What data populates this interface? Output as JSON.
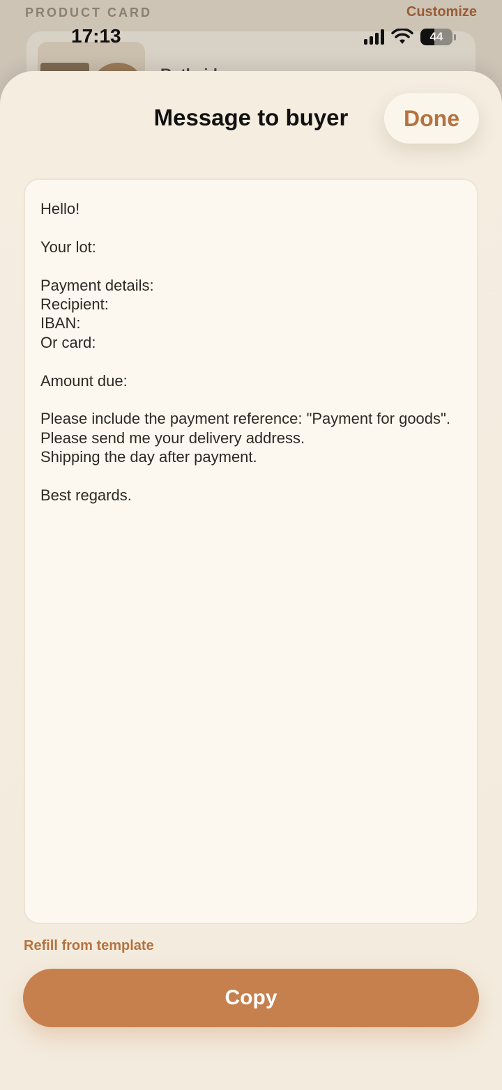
{
  "background": {
    "section_title": "PRODUCT CARD",
    "customize_label": "Customize",
    "card_title": "Rothsid..."
  },
  "status_bar": {
    "time": "17:13",
    "battery": "44"
  },
  "sheet": {
    "title": "Message to buyer",
    "done_label": "Done",
    "message": "Hello!\n\nYour lot:\n\nPayment details:\nRecipient:\nIBAN:\nOr card:\n\nAmount due:\n\nPlease include the payment reference: \"Payment for goods\".\nPlease send me your delivery address.\nShipping the day after payment.\n\nBest regards.",
    "refill_label": "Refill from template",
    "copy_label": "Copy"
  },
  "colors": {
    "accent": "#c6804d",
    "accent_text": "#b5723f",
    "sheet_bg": "#f4ede0",
    "textbox_bg": "#fcf8ef"
  }
}
